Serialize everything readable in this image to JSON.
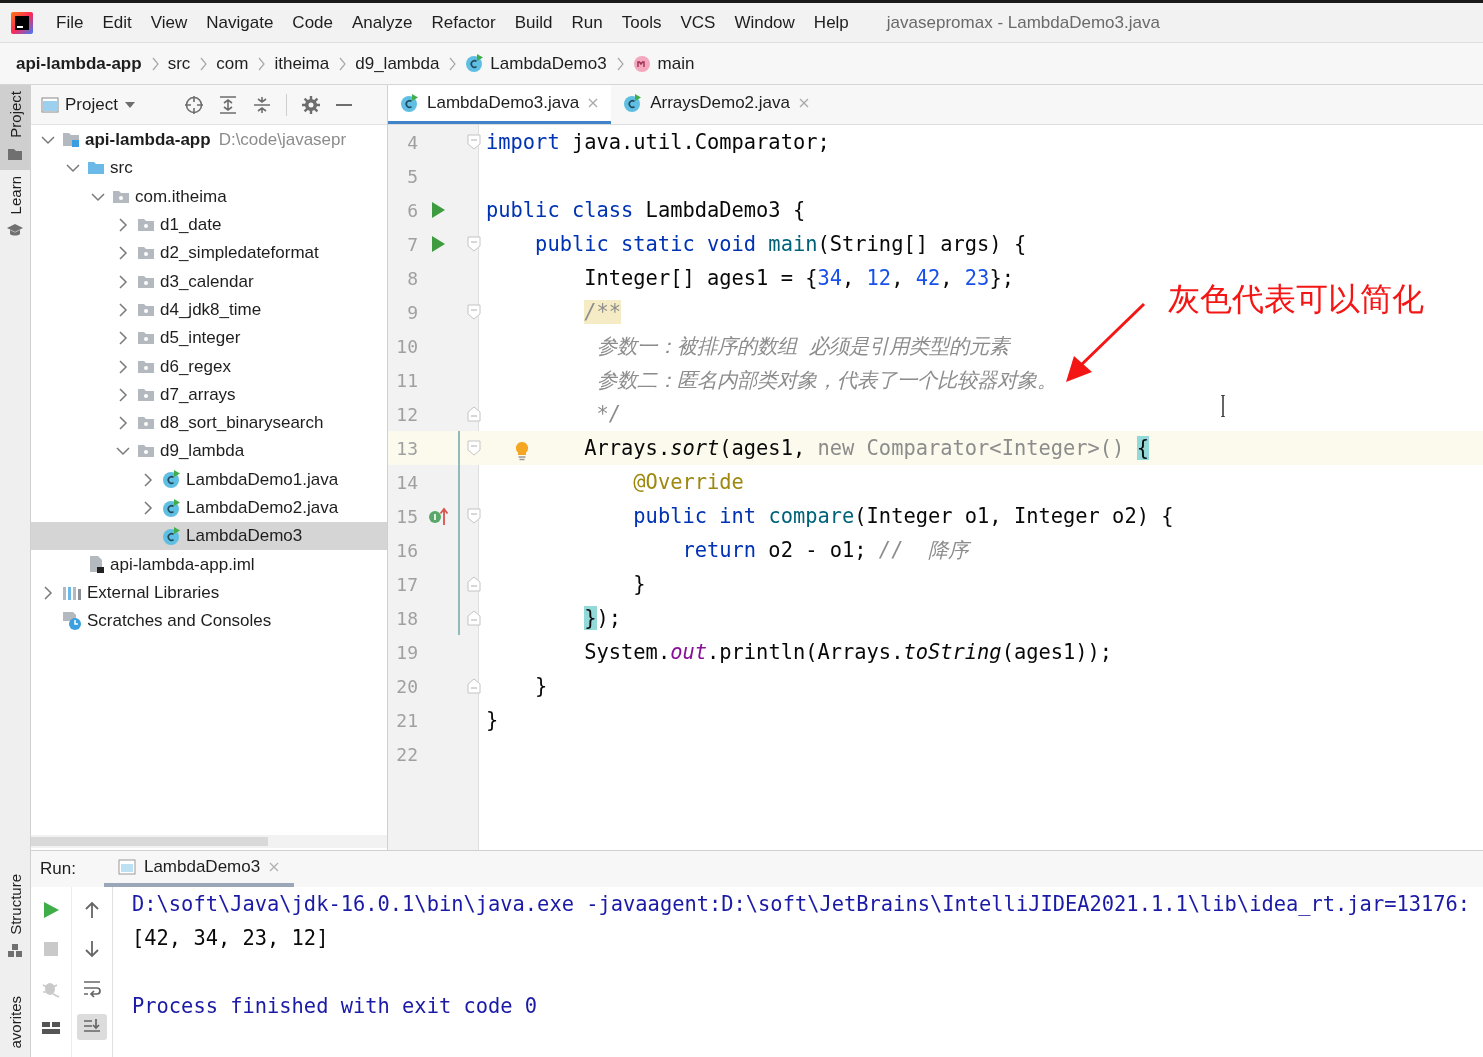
{
  "menu": {
    "items": [
      "File",
      "Edit",
      "View",
      "Navigate",
      "Code",
      "Analyze",
      "Refactor",
      "Build",
      "Run",
      "Tools",
      "VCS",
      "Window",
      "Help"
    ],
    "title": "javasepromax - LambdaDemo3.java"
  },
  "breadcrumb": [
    {
      "label": "api-lambda-app",
      "kind": "project"
    },
    {
      "label": "src",
      "kind": "folder"
    },
    {
      "label": "com",
      "kind": "folder"
    },
    {
      "label": "itheima",
      "kind": "folder"
    },
    {
      "label": "d9_lambda",
      "kind": "folder"
    },
    {
      "label": "LambdaDemo3",
      "kind": "class"
    },
    {
      "label": "main",
      "kind": "method"
    }
  ],
  "side_tabs": [
    {
      "label": "Project",
      "kind": "project",
      "selected": true
    },
    {
      "label": "Learn",
      "kind": "learn",
      "selected": false
    }
  ],
  "side_tabs_bottom": [
    {
      "label": "Structure",
      "kind": "structure",
      "selected": false
    },
    {
      "label": "avorites",
      "kind": "favorites",
      "selected": false
    }
  ],
  "project_panel": {
    "title": "Project",
    "tree": [
      {
        "name": "api-lambda-app",
        "kind": "module",
        "path": "D:\\code\\javasepr",
        "expanded": true,
        "selected": false,
        "children": [
          {
            "name": "src",
            "kind": "source",
            "expanded": true,
            "selected": false,
            "children": [
              {
                "name": "com.itheima",
                "kind": "package",
                "expanded": true,
                "selected": false,
                "children": [
                  {
                    "name": "d1_date",
                    "kind": "package",
                    "expanded": false,
                    "selected": false
                  },
                  {
                    "name": "d2_simpledateformat",
                    "kind": "package",
                    "expanded": false,
                    "selected": false
                  },
                  {
                    "name": "d3_calendar",
                    "kind": "package",
                    "expanded": false,
                    "selected": false
                  },
                  {
                    "name": "d4_jdk8_time",
                    "kind": "package",
                    "expanded": false,
                    "selected": false
                  },
                  {
                    "name": "d5_integer",
                    "kind": "package",
                    "expanded": false,
                    "selected": false
                  },
                  {
                    "name": "d6_regex",
                    "kind": "package",
                    "expanded": false,
                    "selected": false
                  },
                  {
                    "name": "d7_arrays",
                    "kind": "package",
                    "expanded": false,
                    "selected": false
                  },
                  {
                    "name": "d8_sort_binarysearch",
                    "kind": "package",
                    "expanded": false,
                    "selected": false
                  },
                  {
                    "name": "d9_lambda",
                    "kind": "package",
                    "expanded": true,
                    "selected": false,
                    "children": [
                      {
                        "name": "LambdaDemo1.java",
                        "kind": "class",
                        "expanded": false,
                        "selected": false
                      },
                      {
                        "name": "LambdaDemo2.java",
                        "kind": "class",
                        "expanded": false,
                        "selected": false
                      },
                      {
                        "name": "LambdaDemo3",
                        "kind": "class",
                        "selected": true
                      }
                    ]
                  }
                ]
              }
            ]
          },
          {
            "name": "api-lambda-app.iml",
            "kind": "iml",
            "selected": false
          }
        ]
      },
      {
        "name": "External Libraries",
        "kind": "libraries",
        "expanded": false,
        "selected": false
      },
      {
        "name": "Scratches and Consoles",
        "kind": "scratches",
        "selected": false
      }
    ]
  },
  "editor": {
    "tabs": [
      {
        "label": "LambdaDemo3.java",
        "selected": true
      },
      {
        "label": "ArraysDemo2.java",
        "selected": false
      }
    ],
    "lines": [
      {
        "number": "4",
        "gutter": [
          {
            "kind": "fold-start"
          }
        ],
        "tokens": [
          {
            "kind": "kw",
            "text": "import"
          },
          {
            "kind": "plain",
            "text": " java.util.Comparator;"
          }
        ]
      },
      {
        "number": "5"
      },
      {
        "number": "6",
        "gutter": [
          {
            "kind": "run"
          }
        ],
        "tokens": [
          {
            "kind": "kw",
            "text": "public class"
          },
          {
            "kind": "plain",
            "text": " LambdaDemo3 {"
          }
        ]
      },
      {
        "number": "7",
        "gutter": [
          {
            "kind": "run"
          },
          {
            "kind": "fold-start"
          }
        ],
        "tokens": [
          {
            "kind": "kw",
            "text": "    public static void "
          },
          {
            "kind": "method",
            "text": "main"
          },
          {
            "kind": "plain",
            "text": "(String[] args) {"
          }
        ]
      },
      {
        "number": "8",
        "tokens": [
          {
            "kind": "plain",
            "text": "        Integer[] ages1 = {"
          },
          {
            "kind": "num",
            "text": "34"
          },
          {
            "kind": "plain",
            "text": ", "
          },
          {
            "kind": "num",
            "text": "12"
          },
          {
            "kind": "plain",
            "text": ", "
          },
          {
            "kind": "num",
            "text": "42"
          },
          {
            "kind": "plain",
            "text": ", "
          },
          {
            "kind": "num",
            "text": "23"
          },
          {
            "kind": "plain",
            "text": "};"
          }
        ]
      },
      {
        "number": "9",
        "gutter": [
          {
            "kind": "fold-start"
          }
        ],
        "tokens": [
          {
            "kind": "docstart",
            "text": "        /**"
          }
        ]
      },
      {
        "number": "10",
        "tokens": [
          {
            "kind": "doc",
            "text": "         参数一：被排序的数组 必须是引用类型的元素"
          }
        ]
      },
      {
        "number": "11",
        "tokens": [
          {
            "kind": "doc",
            "text": "         参数二：匿名内部类对象，代表了一个比较器对象。"
          }
        ]
      },
      {
        "number": "12",
        "gutter": [
          {
            "kind": "fold-end"
          }
        ],
        "tokens": [
          {
            "kind": "doc",
            "text": "         */"
          }
        ]
      },
      {
        "number": "13",
        "current": true,
        "changed": true,
        "gutter": [
          {
            "kind": "fold-start"
          },
          {
            "kind": "intention"
          }
        ],
        "tokens": [
          {
            "kind": "plain",
            "text": "        Arrays."
          },
          {
            "kind": "italic",
            "text": "sort"
          },
          {
            "kind": "plain",
            "text": "(ages1, "
          },
          {
            "kind": "gray",
            "text": "new Comparator<Integer>() "
          },
          {
            "kind": "brace",
            "text": "{"
          }
        ]
      },
      {
        "number": "14",
        "changed": true,
        "tokens": [
          {
            "kind": "annot",
            "text": "            @Override"
          }
        ]
      },
      {
        "number": "15",
        "changed": true,
        "gutter": [
          {
            "kind": "implements"
          },
          {
            "kind": "fold-start"
          }
        ],
        "tokens": [
          {
            "kind": "kw",
            "text": "            public int "
          },
          {
            "kind": "method",
            "text": "compare"
          },
          {
            "kind": "plain",
            "text": "(Integer o1, Integer o2) {"
          }
        ]
      },
      {
        "number": "16",
        "changed": true,
        "tokens": [
          {
            "kind": "kw",
            "text": "                return"
          },
          {
            "kind": "plain",
            "text": " o2 - o1; "
          },
          {
            "kind": "comment",
            "text": "//  降序"
          }
        ]
      },
      {
        "number": "17",
        "changed": true,
        "gutter": [
          {
            "kind": "fold-end"
          }
        ],
        "tokens": [
          {
            "kind": "plain",
            "text": "            }"
          }
        ]
      },
      {
        "number": "18",
        "changed": true,
        "gutter": [
          {
            "kind": "fold-end"
          }
        ],
        "tokens": [
          {
            "kind": "brace",
            "text": "        }"
          },
          {
            "kind": "plain",
            "text": ");"
          }
        ]
      },
      {
        "number": "19",
        "tokens": [
          {
            "kind": "plain",
            "text": "        System."
          },
          {
            "kind": "field",
            "text": "out"
          },
          {
            "kind": "plain",
            "text": ".println(Arrays."
          },
          {
            "kind": "italic",
            "text": "toString"
          },
          {
            "kind": "plain",
            "text": "(ages1));"
          }
        ]
      },
      {
        "number": "20",
        "gutter": [
          {
            "kind": "fold-end"
          }
        ],
        "tokens": [
          {
            "kind": "plain",
            "text": "    }"
          }
        ]
      },
      {
        "number": "21",
        "tokens": [
          {
            "kind": "plain",
            "text": "}"
          }
        ]
      },
      {
        "number": "22"
      }
    ]
  },
  "annotation": {
    "text": "灰色代表可以简化"
  },
  "run_panel": {
    "label": "Run:",
    "tab": "LambdaDemo3",
    "output": [
      {
        "kind": "command",
        "text": "D:\\soft\\Java\\jdk-16.0.1\\bin\\java.exe -javaagent:D:\\soft\\JetBrains\\IntelliJIDEA2021.1.1\\lib\\idea_rt.jar=13176:"
      },
      {
        "kind": "stdout",
        "text": "[42, 34, 23, 12]"
      },
      {
        "kind": "status",
        "text": "Process finished with exit code 0"
      }
    ]
  }
}
